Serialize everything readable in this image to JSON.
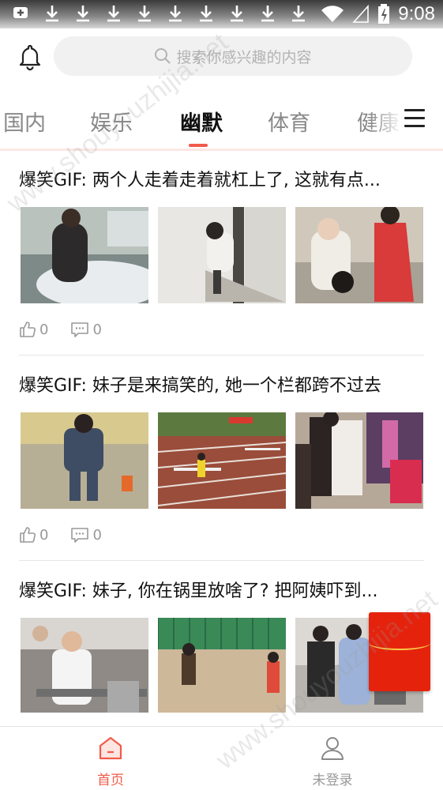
{
  "status_bar": {
    "time": "9:08",
    "left_icons": [
      "add-notification-icon",
      "download-icon",
      "download-icon",
      "download-icon",
      "download-icon",
      "download-icon",
      "download-icon",
      "download-icon",
      "download-icon",
      "download-icon"
    ],
    "right_icons": [
      "wifi-icon",
      "signal-icon",
      "battery-charging-icon"
    ]
  },
  "header": {
    "bell_icon": "bell-icon",
    "search_placeholder": "搜索你感兴趣的内容"
  },
  "tabs": [
    "国内",
    "娱乐",
    "幽默",
    "体育",
    "健康"
  ],
  "active_tab": "幽默",
  "colors": {
    "accent": "#f25a4b",
    "red_packet": "#e5230d",
    "search_bg": "#f1f1f1"
  },
  "articles": [
    {
      "title": "爆笑GIF: 两个人走着走着就杠上了, 这就有点...",
      "likes": "0",
      "comments": "0"
    },
    {
      "title": "爆笑GIF: 妹子是来搞笑的, 她一个栏都跨不过去",
      "likes": "0",
      "comments": "0"
    },
    {
      "title": "爆笑GIF: 妹子, 你在锅里放啥了? 把阿姨吓到..."
    }
  ],
  "bottom_nav": [
    {
      "label": "首页",
      "icon": "home-icon",
      "active": true
    },
    {
      "label": "未登录",
      "icon": "user-icon",
      "active": false
    }
  ],
  "watermark": "www.shouyouzhijia.net"
}
